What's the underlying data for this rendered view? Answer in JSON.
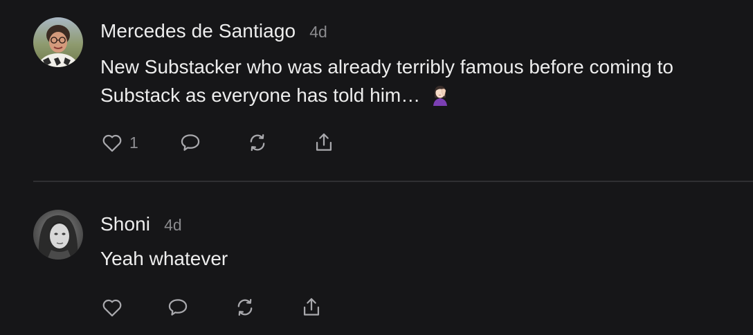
{
  "comments": [
    {
      "author": "Mercedes de Santiago",
      "time": "4d",
      "text": "New Substacker who was already terribly famous before coming to Substack as everyone has told him…",
      "emoji_icon": "woman-facepalming-emoji",
      "like_count": "1",
      "avatar_icon": "woman-with-glasses-avatar"
    },
    {
      "author": "Shoni",
      "time": "4d",
      "text": "Yeah whatever",
      "like_count": "",
      "avatar_icon": "grayscale-portrait-avatar"
    }
  ],
  "icons": {
    "like": "heart-icon",
    "reply": "speech-bubble-icon",
    "restack": "restack-icon",
    "share": "share-icon"
  },
  "colors": {
    "background": "#161618",
    "text": "#ededed",
    "muted": "#8a8a8d",
    "icon": "#a9a9ad",
    "divider": "#2f2f32"
  }
}
